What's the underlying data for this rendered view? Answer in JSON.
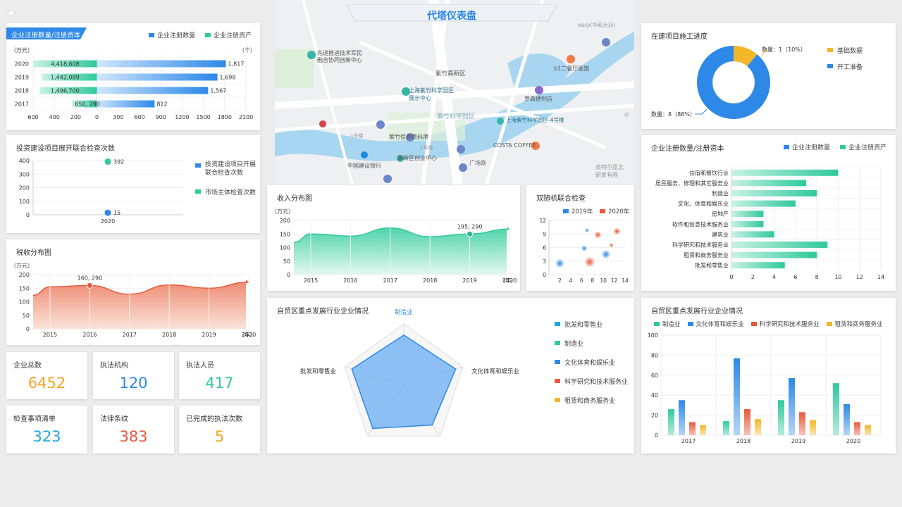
{
  "header": {
    "title": "代塔仪表盘"
  },
  "colors": {
    "blue": "#2d88e8",
    "green": "#2fc99a",
    "red": "#e8583a",
    "yellow": "#f2b82a",
    "orange": "#f5a623",
    "cyan": "#1aa7e0"
  },
  "reg_top": {
    "title": "企业注册数量/注册资本",
    "legend": [
      "企业注册数量",
      "企业注册资产"
    ],
    "unit_left": "（万元）",
    "unit_right": "（个）",
    "chart_data": {
      "type": "bar",
      "categories": [
        "2020",
        "2019",
        "2018",
        "2017"
      ],
      "series": [
        {
          "name": "企业注册资产",
          "values": [
            4418608,
            1442089,
            1496700,
            650290
          ],
          "labels": [
            "4,418,608",
            "1,442,089",
            "1,496,700",
            "650, 290"
          ]
        },
        {
          "name": "企业注册数量",
          "values": [
            1817,
            1698,
            1567,
            812
          ],
          "labels": [
            "1,817",
            "1,698",
            "1,567",
            "812"
          ]
        }
      ],
      "xticks": [
        "600",
        "400",
        "200",
        "0",
        "300",
        "600",
        "900",
        "1200",
        "1500",
        "1800",
        "2100"
      ],
      "xlim": [
        0,
        2100
      ]
    }
  },
  "inspect": {
    "title": "投资建设项目展开联合检查次数",
    "legend": [
      "投资建设项目开展联合检查次数",
      "市场主体检查次数"
    ],
    "chart_data": {
      "type": "scatter",
      "categories": [
        "2020"
      ],
      "series": [
        {
          "name": "投资建设项目开展联合检查次数",
          "values": [
            15
          ],
          "label": "15"
        },
        {
          "name": "市场主体检查次数",
          "values": [
            392
          ],
          "label": "392"
        }
      ],
      "yticks": [
        "400",
        "300",
        "200",
        "100",
        "0"
      ],
      "ylim": [
        0,
        400
      ]
    }
  },
  "tax": {
    "title": "税收分布图",
    "unit": "（万元）",
    "chart_data": {
      "type": "area",
      "x": [
        "2015",
        "2016",
        "2017",
        "2018",
        "2019",
        "2020"
      ],
      "values": [
        155,
        160,
        128,
        162,
        150,
        172
      ],
      "highlight": {
        "x": "2016",
        "label": "160, 290"
      },
      "yticks": [
        "200",
        "150",
        "100",
        "50",
        "0"
      ],
      "ylim": [
        0,
        200
      ],
      "xunit": "（年）"
    }
  },
  "stats": [
    {
      "label": "企业总数",
      "value": "6452"
    },
    {
      "label": "执法机构",
      "value": "120"
    },
    {
      "label": "执法人员",
      "value": "417"
    },
    {
      "label": "检查事项清单",
      "value": "323"
    },
    {
      "label": "法律条纹",
      "value": "383"
    },
    {
      "label": "已完成的执法次数",
      "value": "5"
    }
  ],
  "map": {
    "labels": [
      "先进推进技术军民",
      "融合协同创新中心",
      "紫竹高新区",
      "上海紫竹科学园区",
      "展示中心",
      "b1二餐厅面馆",
      "罗森便利店",
      "紫竹科学园区",
      "上海紫竹科学园区-4号楼",
      "紫竹信息数码港",
      "COSTA COFFEE",
      "中国建设银行",
      "高新区创业中心",
      "广场路",
      "1号楼",
      "2号楼",
      "英特尔亚太",
      "研发有限",
      "easy(华和大店)",
      "中"
    ]
  },
  "income": {
    "title": "收入分布图",
    "unit": "（万元）",
    "chart_data": {
      "type": "area",
      "x": [
        "2015",
        "2016",
        "2017",
        "2018",
        "2019",
        "2020"
      ],
      "values": [
        150,
        142,
        172,
        140,
        150,
        168
      ],
      "highlight": {
        "x": "2019",
        "label": "195, 290"
      },
      "yticks": [
        "200",
        "150",
        "100",
        "50",
        "0"
      ],
      "ylim": [
        0,
        200
      ],
      "xunit": "（年）"
    }
  },
  "random": {
    "title": "双随机联合检查",
    "legend": [
      "2019年",
      "2020年"
    ],
    "chart_data": {
      "type": "scatter",
      "series": [
        {
          "name": "2019年",
          "points": [
            [
              2,
              2.5
            ],
            [
              6.5,
              5.8
            ],
            [
              7,
              9.8
            ],
            [
              10.5,
              4.5
            ]
          ]
        },
        {
          "name": "2020年",
          "points": [
            [
              7.5,
              2.8
            ],
            [
              9,
              8.8
            ],
            [
              11.5,
              6.5
            ],
            [
              12.5,
              9.6
            ]
          ]
        }
      ],
      "xticks": [
        "2",
        "4",
        "6",
        "8",
        "10",
        "12",
        "14"
      ],
      "yticks": [
        "12",
        "9",
        "6",
        "3",
        "0"
      ],
      "xlim": [
        0,
        14
      ],
      "ylim": [
        0,
        12
      ]
    }
  },
  "radar": {
    "title": "自贸区重点发展行业企业情况",
    "legend": [
      "批发和零售业",
      "制造业",
      "文化体育和娱乐业",
      "科学研究和技术服务业",
      "租赁和商务服务业"
    ],
    "chart_data": {
      "type": "radar",
      "axes": [
        "制造业",
        "文化体育和娱乐业",
        "科学研究和技术服务业",
        "租赁和商务服务业",
        "批发和零售业"
      ],
      "values": [
        0.82,
        0.88,
        0.78,
        0.85,
        0.88
      ],
      "max": 1
    }
  },
  "progress": {
    "title": "在建项目施工进度",
    "legend": [
      "基础数据",
      "开工准备"
    ],
    "chart_data": {
      "type": "pie",
      "slices": [
        {
          "name": "基础数据",
          "value": 1,
          "label": "数量：1（10%）"
        },
        {
          "name": "开工准备",
          "value": 8,
          "label": "数量：8（88%）"
        }
      ]
    }
  },
  "reg_ind": {
    "title": "企业注册数量/注册资本",
    "legend": [
      "企业注册数量",
      "企业注册资产"
    ],
    "chart_data": {
      "type": "bar",
      "categories": [
        "住宿和餐饮行业",
        "居民服务、修理和其它服务业",
        "制造业",
        "文化、体育和娱乐业",
        "房地产",
        "软件和信息技术服务业",
        "建筑业",
        "科学研究和技术服务业",
        "租赁和商务服务业",
        "批发和零售业"
      ],
      "values": [
        10,
        7,
        8,
        6,
        3,
        3,
        4,
        9,
        8,
        5
      ],
      "xticks": [
        "0",
        "2",
        "4",
        "6",
        "8",
        "10",
        "12",
        "14"
      ],
      "xlim": [
        0,
        14
      ]
    }
  },
  "ind_bar": {
    "title": "自贸区重点发展行业企业情况",
    "legend": [
      "制造业",
      "文化体育和娱乐业",
      "科学研究和技术服务业",
      "租赁和商务服务业"
    ],
    "chart_data": {
      "type": "bar",
      "categories": [
        "2017",
        "2018",
        "2019",
        "2020"
      ],
      "series": [
        {
          "name": "制造业",
          "values": [
            26,
            14,
            35,
            52
          ]
        },
        {
          "name": "文化体育和娱乐业",
          "values": [
            35,
            77,
            57,
            31
          ]
        },
        {
          "name": "科学研究和技术服务业",
          "values": [
            13,
            26,
            23,
            13
          ]
        },
        {
          "name": "租赁和商务服务业",
          "values": [
            10,
            16,
            15,
            10
          ]
        }
      ],
      "yticks": [
        "100",
        "80",
        "60",
        "40",
        "20",
        "0"
      ],
      "ylim": [
        0,
        100
      ]
    }
  }
}
